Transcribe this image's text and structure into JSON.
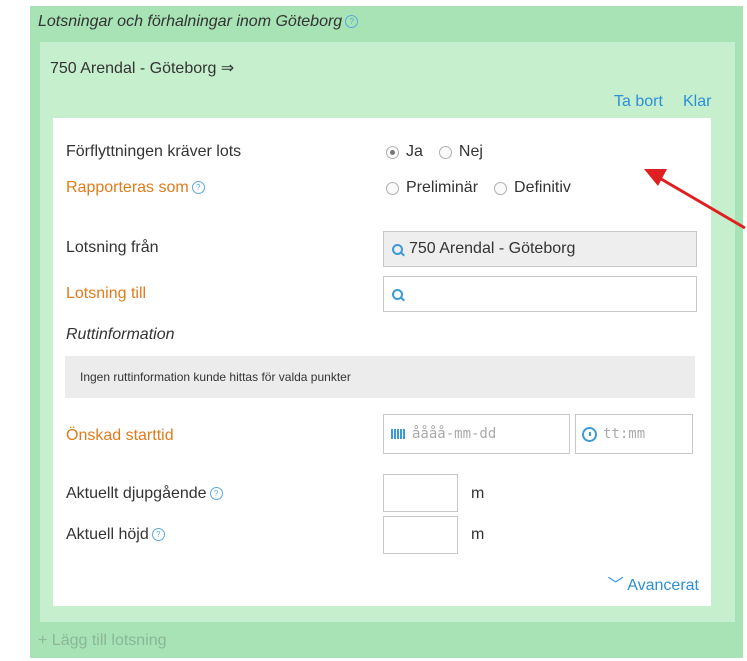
{
  "section": {
    "title": "Lotsningar och förhalningar inom Göteborg"
  },
  "card": {
    "title": "750 Arendal - Göteborg ⇒",
    "remove_label": "Ta bort",
    "done_label": "Klar"
  },
  "form": {
    "requires_pilot": {
      "label": "Förflyttningen kräver lots",
      "options": [
        "Ja",
        "Nej"
      ],
      "selected": "Ja"
    },
    "reported_as": {
      "label": "Rapporteras som",
      "options": [
        "Preliminär",
        "Definitiv"
      ],
      "selected": ""
    },
    "pilot_from": {
      "label": "Lotsning från",
      "value": "750 Arendal - Göteborg"
    },
    "pilot_to": {
      "label": "Lotsning till",
      "value": ""
    },
    "route_info": {
      "label": "Ruttinformation",
      "message": "Ingen ruttinformation kunde hittas för valda punkter"
    },
    "start_time": {
      "label": "Önskad starttid",
      "date_placeholder": "åååå-mm-dd",
      "time_placeholder": "tt:mm"
    },
    "draught": {
      "label": "Aktuellt djupgående",
      "value": "",
      "unit": "m"
    },
    "height": {
      "label": "Aktuell höjd",
      "value": "",
      "unit": "m"
    },
    "advanced_label": "Avancerat"
  },
  "add_pilotage_label": "Lägg till lotsning",
  "colors": {
    "outer_bg": "#a7e3b5",
    "card_bg": "#c6efce",
    "link": "#2d8fd5",
    "required_label": "#e07b1b",
    "annotation_arrow": "#e02020"
  },
  "icons": {
    "help": "help-circle-icon",
    "search": "search-icon",
    "calendar": "calendar-icon",
    "clock": "clock-icon",
    "chevron": "chevron-down-icon",
    "plus": "plus-icon"
  }
}
